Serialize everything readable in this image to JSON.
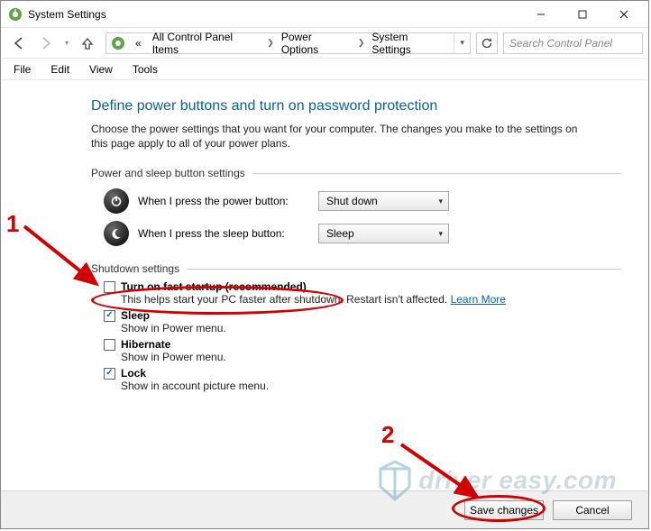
{
  "window": {
    "title": "System Settings"
  },
  "breadcrumbs": {
    "prefix": "«",
    "items": [
      "All Control Panel Items",
      "Power Options",
      "System Settings"
    ]
  },
  "search": {
    "placeholder": "Search Control Panel"
  },
  "menubar": [
    "File",
    "Edit",
    "View",
    "Tools"
  ],
  "main": {
    "heading": "Define power buttons and turn on password protection",
    "subtext": "Choose the power settings that you want for your computer. The changes you make to the settings on this page apply to all of your power plans.",
    "group1_label": "Power and sleep button settings",
    "power_button_label": "When I press the power button:",
    "power_button_value": "Shut down",
    "sleep_button_label": "When I press the sleep button:",
    "sleep_button_value": "Sleep",
    "group2_label": "Shutdown settings",
    "shutdown_options": [
      {
        "label": "Turn on fast startup (recommended)",
        "desc_prefix": "This helps start your PC faster after shutdown. Restart isn't affected. ",
        "learn_more": "Learn More",
        "checked": false
      },
      {
        "label": "Sleep",
        "desc": "Show in Power menu.",
        "checked": true
      },
      {
        "label": "Hibernate",
        "desc": "Show in Power menu.",
        "checked": false
      },
      {
        "label": "Lock",
        "desc": "Show in account picture menu.",
        "checked": true
      }
    ]
  },
  "footer": {
    "save_label": "Save changes",
    "cancel_label": "Cancel"
  },
  "annotations": {
    "num1": "1",
    "num2": "2"
  },
  "watermark": {
    "text": "driver easy.com"
  }
}
